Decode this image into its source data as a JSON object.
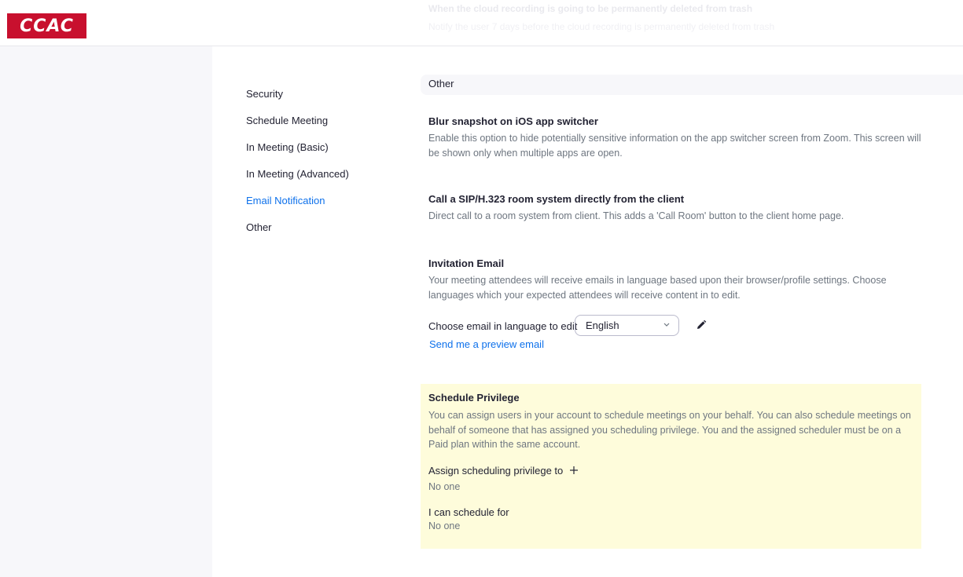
{
  "header": {
    "logo_text": "CCAC",
    "ghost_title": "When the cloud recording is going to be permanently deleted from trash",
    "ghost_desc": "Notify the user 7 days before the cloud recording is permanently deleted from trash"
  },
  "nav": {
    "items": [
      {
        "label": "Security"
      },
      {
        "label": "Schedule Meeting"
      },
      {
        "label": "In Meeting (Basic)"
      },
      {
        "label": "In Meeting (Advanced)"
      },
      {
        "label": "Email Notification",
        "active": true
      },
      {
        "label": "Other"
      }
    ],
    "active_color": "#0e71eb"
  },
  "section": {
    "title": "Other"
  },
  "settings": {
    "blur": {
      "title": "Blur snapshot on iOS app switcher",
      "desc": "Enable this option to hide potentially sensitive information on the app switcher screen from Zoom. This screen will be shown only when multiple apps are open."
    },
    "sip": {
      "title": "Call a SIP/H.323 room system directly from the client",
      "desc": "Direct call to a room system from client. This adds a 'Call Room' button to the client home page."
    },
    "invitation": {
      "title": "Invitation Email",
      "desc": "Your meeting attendees will receive emails in language based upon their browser/profile settings. Choose languages which your expected attendees will receive content in to edit.",
      "choose_label": "Choose email in language to edit",
      "language_selected": "English",
      "preview_link": "Send me a preview email",
      "icons": {
        "dropdown": "chevron-down-icon",
        "edit": "pencil-icon"
      }
    },
    "privilege": {
      "title": "Schedule Privilege",
      "desc": "You can assign users in your account to schedule meetings on your behalf. You can also schedule meetings on behalf of someone that has assigned you scheduling privilege. You and the assigned scheduler must be on a Paid plan within the same account.",
      "assign_label": "Assign scheduling privilege to",
      "assign_value": "No one",
      "schedule_for_label": "I can schedule for",
      "schedule_for_value": "No one",
      "highlight_color": "#fefcdb",
      "icons": {
        "add": "plus-icon"
      }
    }
  },
  "colors": {
    "brand": "#c8102e",
    "link": "#0e71eb",
    "text": "#232333",
    "muted": "#6e7680"
  }
}
